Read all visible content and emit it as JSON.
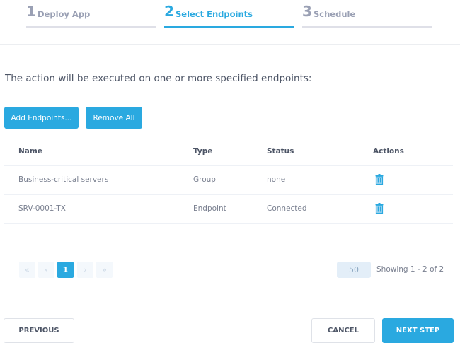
{
  "stepper": {
    "steps": [
      {
        "number": "1",
        "label": "Deploy App",
        "state": "completed"
      },
      {
        "number": "2",
        "label": "Select Endpoints",
        "state": "active"
      },
      {
        "number": "3",
        "label": "Schedule",
        "state": "pending"
      }
    ]
  },
  "description": "The action will be executed on one or more specified endpoints:",
  "toolbar": {
    "add_label": "Add Endpoints...",
    "remove_all_label": "Remove All"
  },
  "table": {
    "columns": [
      "Name",
      "Type",
      "Status",
      "Actions"
    ],
    "rows": [
      {
        "name": "Business-critical servers",
        "type": "Group",
        "status": "none",
        "action_icon": "trash-icon"
      },
      {
        "name": "SRV-0001-TX",
        "type": "Endpoint",
        "status": "Connected",
        "action_icon": "trash-icon"
      }
    ]
  },
  "pagination": {
    "first": "«",
    "prev": "‹",
    "current": "1",
    "next": "›",
    "last": "»",
    "per_page": "50",
    "showing": "Showing 1 - 2 of 2"
  },
  "footer": {
    "previous_label": "PREVIOUS",
    "cancel_label": "CANCEL",
    "next_label": "NEXT STEP"
  },
  "colors": {
    "accent": "#2aa9e0",
    "inactive_step": "#9aa0b4"
  }
}
